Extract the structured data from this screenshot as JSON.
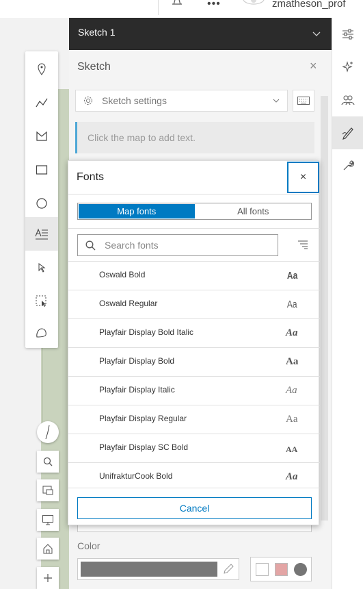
{
  "topbar": {
    "user": "zmatheson_prof"
  },
  "panel": {
    "header_title": "Sketch 1",
    "sketch_title": "Sketch",
    "settings_label": "Sketch settings",
    "hint": "Click the map to add text.",
    "color_label": "Color",
    "color_value": "#787878",
    "presets": [
      "#ffffff",
      "#e3a5a5",
      "#757575"
    ]
  },
  "fonts_dialog": {
    "title": "Fonts",
    "close_glyph": "×",
    "tabs": [
      {
        "label": "Map fonts",
        "selected": true
      },
      {
        "label": "All fonts",
        "selected": false
      }
    ],
    "search_placeholder": "Search fonts",
    "fonts": [
      {
        "name": "Oswald Bold",
        "sample": "Aa"
      },
      {
        "name": "Oswald Regular",
        "sample": "Aa"
      },
      {
        "name": "Playfair Display Bold Italic",
        "sample": "Aa"
      },
      {
        "name": "Playfair Display Bold",
        "sample": "Aa"
      },
      {
        "name": "Playfair Display Italic",
        "sample": "Aa"
      },
      {
        "name": "Playfair Display Regular",
        "sample": "Aa"
      },
      {
        "name": "Playfair Display SC Bold",
        "sample": "AA"
      },
      {
        "name": "UnifrakturCook Bold",
        "sample": "Aa"
      }
    ],
    "cancel_label": "Cancel"
  },
  "colors": {
    "accent": "#007ac2",
    "header": "#2b2b2b",
    "map_green": "#c9d3bd"
  }
}
